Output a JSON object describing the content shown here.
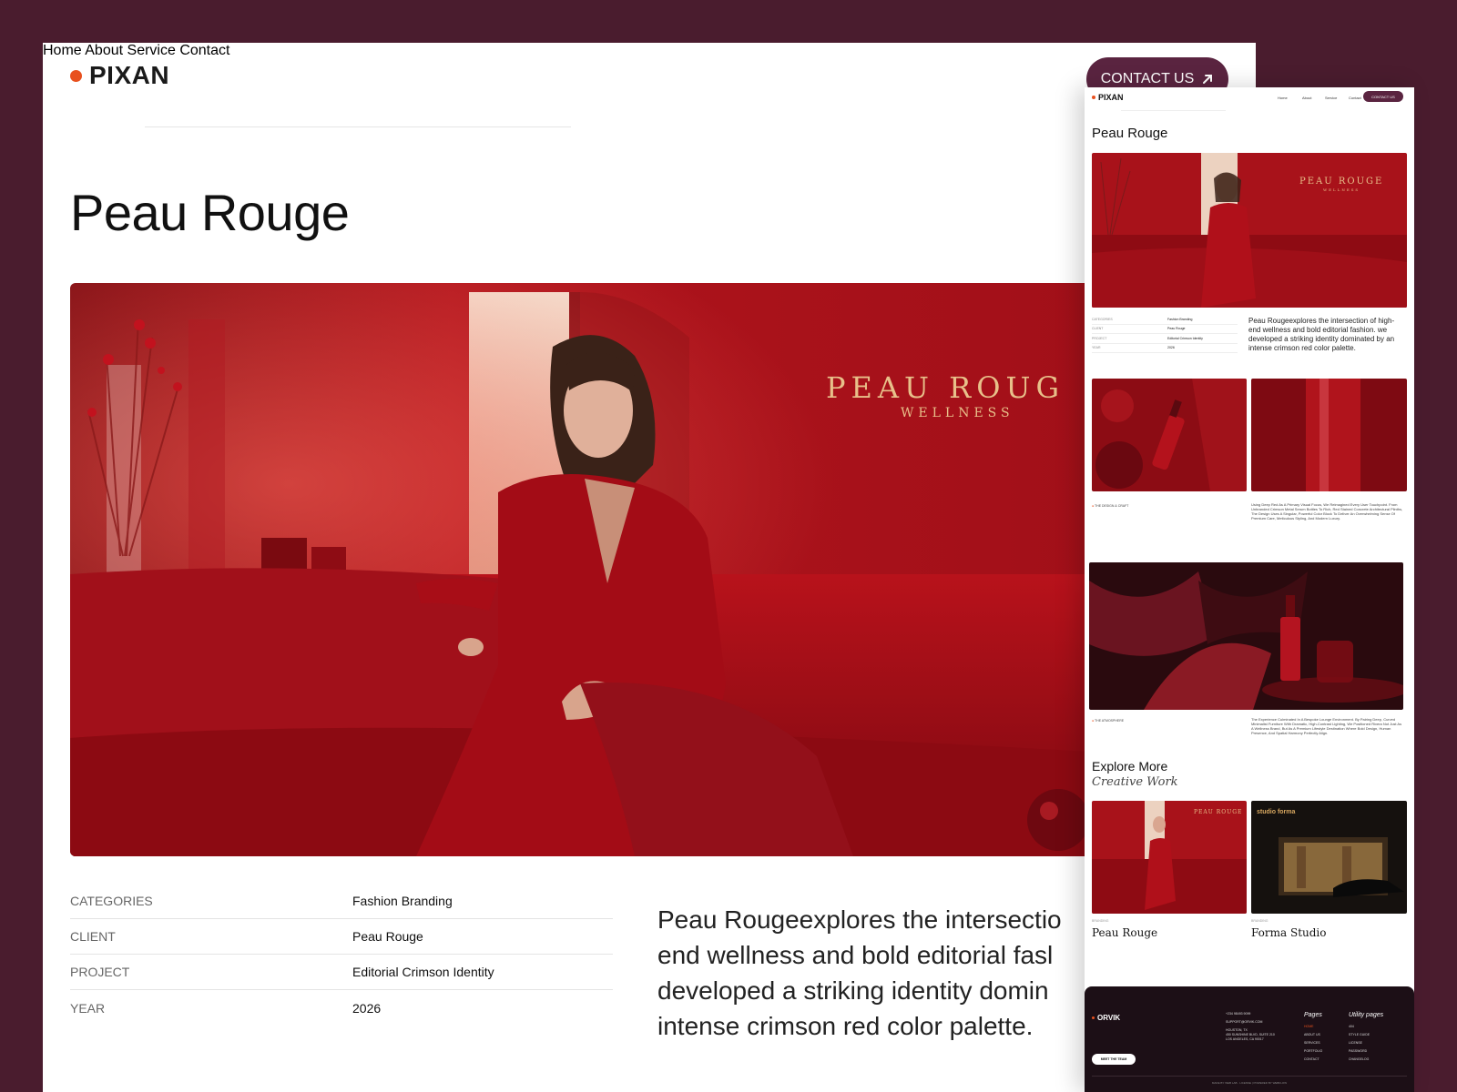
{
  "brand": {
    "name": "PIXAN",
    "accent": "#e8501e",
    "cta_bg": "#5a2440",
    "frame_bg": "#4a1c2e"
  },
  "nav": {
    "items": [
      "Home",
      "About",
      "Service",
      "Contact"
    ],
    "cta_label": "CONTACT US"
  },
  "project": {
    "title": "Peau Rouge",
    "hero_sign": {
      "line1": "PEAU ROUG",
      "line2": "WELLNESS"
    },
    "meta": [
      {
        "key": "CATEGORIES",
        "value": "Fashion Branding"
      },
      {
        "key": "CLIENT",
        "value": "Peau Rouge"
      },
      {
        "key": "PROJECT",
        "value": "Editorial Crimson Identity"
      },
      {
        "key": "YEAR",
        "value": "2026"
      }
    ],
    "description_visible": "Peau Rougeexplores the intersectio end wellness and bold editorial fasl developed a striking identity domin intense crimson red color palette.",
    "description_lines": [
      "Peau Rougeexplores the intersectio",
      "end wellness and bold editorial fasl",
      "developed a striking identity domin",
      "intense crimson red color palette."
    ]
  },
  "mini": {
    "brand": "PIXAN",
    "nav": [
      "Home",
      "About",
      "Service",
      "Contact"
    ],
    "cta": "CONTACT US",
    "title": "Peau Rouge",
    "hero_sign": {
      "line1": "PEAU ROUGE",
      "line2": "WELLNESS"
    },
    "meta": [
      {
        "key": "CATEGORIES",
        "value": "Fashion Branding"
      },
      {
        "key": "CLIENT",
        "value": "Peau Rouge"
      },
      {
        "key": "PROJECT",
        "value": "Editorial Crimson Identity"
      },
      {
        "key": "YEAR",
        "value": "2026"
      }
    ],
    "description": "Peau Rougeexplores the intersection of high-end wellness and bold editorial fashion. we developed a striking identity dominated by an intense crimson red color palette.",
    "section1_tag": "THE DESIGN & CRAFT",
    "section1_text": "Using Deep Red As A Primary Visual Focus, We Reimagined Every User Touchpoint. From Unbranded Crimson Metal Serum Bottles To Rich, Red Stained Concrete Architectural Plinths, The Design Uses A Singular, Powerful Color Block To Deliver An Overwhelming Sense Of Premium Care, Meticulous Styling, And Modern Luxury.",
    "section2_tag": "THE ATMOSPHERE",
    "section2_text": "The Experience Culminated In A Bespoke Lounge Environment. By Pairing Deep, Curved Minimalist Furniture With Dramatic, High-Contrast Lighting, We Positioned Rivera Not Just As A Wellness Brand, But As A Premium Lifestyle Destination Where Bold Design, Human Presence, And Spatial Harmony Perfectly Align.",
    "explore_title": "Explore More",
    "explore_subtitle": "Creative Work",
    "cards": [
      {
        "category": "BRANDING",
        "title": "Peau Rouge",
        "sign": "PEAU ROUGE"
      },
      {
        "category": "BRANDING",
        "title": "Forma Studio",
        "sign": "studio forma"
      }
    ],
    "footer": {
      "brand": "ORVIK",
      "button": "MEET THE TEAM",
      "contact": [
        "+234 98493 9099",
        "SUPPORT@ORVIK.COM",
        "HOUSTON, TX",
        "450 SUNSHINE BLVD, SUITE 210",
        "LOS ANGELES, CA 90017"
      ],
      "pages_heading": "Pages",
      "pages": [
        "HOME",
        "ABOUT US",
        "SERVICES",
        "PORTFOLIO",
        "CONTACT"
      ],
      "utility_heading": "Utility pages",
      "utility": [
        "404",
        "STYLE GUIDE",
        "LICENSE",
        "PASSWORD",
        "CHANGELOG"
      ],
      "bottom": "MADE BY WEB LAB · LICENSE | POWERED BY WEBFLOW"
    }
  }
}
